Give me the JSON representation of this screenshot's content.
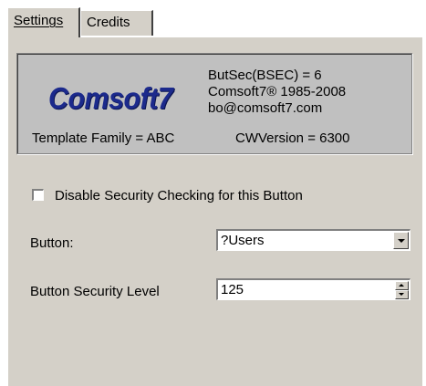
{
  "tabs": {
    "settings": "Settings",
    "credits": "Credits"
  },
  "info": {
    "logo": "Comsoft7",
    "butsec": "ButSec(BSEC) = 6",
    "copyright": "Comsoft7® 1985-2008",
    "email": "bo@comsoft7.com",
    "template_family": "Template Family = ABC",
    "cwversion": "CWVersion = 6300"
  },
  "security": {
    "disable_label": "Disable Security Checking for this Button",
    "disable_checked": false
  },
  "fields": {
    "button_label": "Button:",
    "button_value": "?Users",
    "level_label": "Button Security Level",
    "level_value": "125"
  },
  "colors": {
    "panel": "#d4d0c8",
    "infobox": "#c0c0c0",
    "logo": "#1c2a8c"
  }
}
